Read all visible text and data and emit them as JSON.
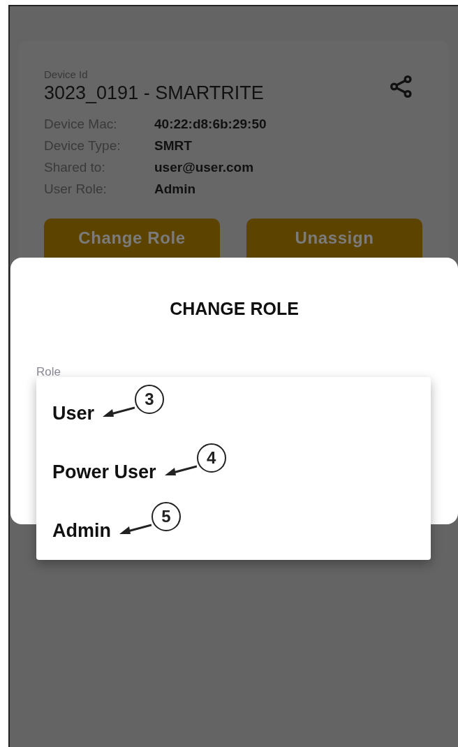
{
  "device_card": {
    "id_label": "Device Id",
    "title": "3023_0191 - SMARTRITE",
    "fields": [
      {
        "label": "Device Mac:",
        "value": "40:22:d8:6b:29:50"
      },
      {
        "label": "Device Type:",
        "value": "SMRT"
      },
      {
        "label": "Shared to:",
        "value": "user@user.com"
      },
      {
        "label": "User Role:",
        "value": "Admin"
      }
    ],
    "buttons": [
      "Change Role",
      "Unassign"
    ]
  },
  "dialog": {
    "title": "CHANGE ROLE",
    "field_label": "Role",
    "options": [
      {
        "label": "User",
        "callout": "3"
      },
      {
        "label": "Power User",
        "callout": "4"
      },
      {
        "label": "Admin",
        "callout": "5"
      }
    ]
  }
}
